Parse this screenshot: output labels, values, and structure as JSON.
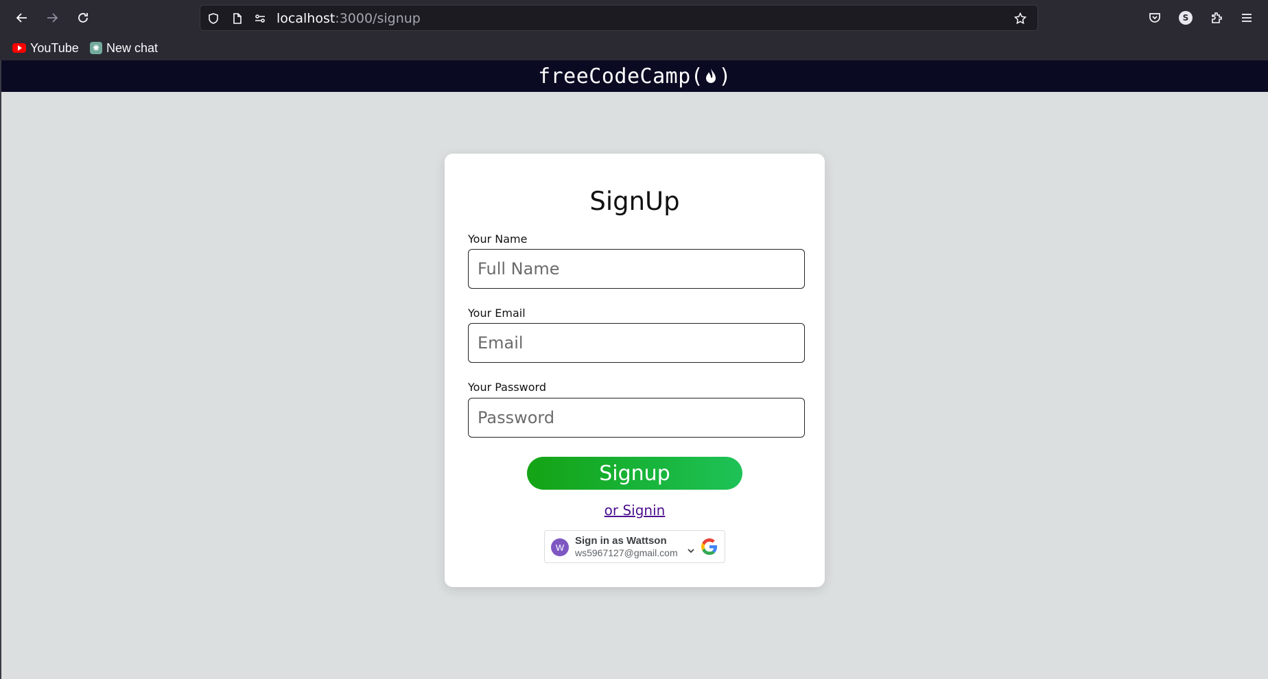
{
  "browser": {
    "url_host": "localhost",
    "url_rest": ":3000/signup",
    "profile_initial": "S",
    "bookmarks": [
      {
        "label": "YouTube",
        "icon": "youtube-icon"
      },
      {
        "label": "New chat",
        "icon": "chatgpt-icon"
      }
    ]
  },
  "site": {
    "logo_text": "freeCodeCamp(",
    "logo_close": ")"
  },
  "form": {
    "title": "SignUp",
    "name_label": "Your Name",
    "name_placeholder": "Full Name",
    "name_value": "",
    "email_label": "Your Email",
    "email_placeholder": "Email",
    "email_value": "",
    "password_label": "Your Password",
    "password_placeholder": "Password",
    "password_value": "",
    "submit_label": "Signup",
    "signin_link": "or Signin"
  },
  "google_signin": {
    "avatar_initial": "W",
    "title": "Sign in as Wattson",
    "email": "ws5967127@gmail.com"
  },
  "colors": {
    "header_bg": "#0a0a23",
    "page_bg": "#dcdfe0",
    "button_start": "#14a314",
    "button_end": "#1ec257",
    "link": "#4b0f8f"
  }
}
